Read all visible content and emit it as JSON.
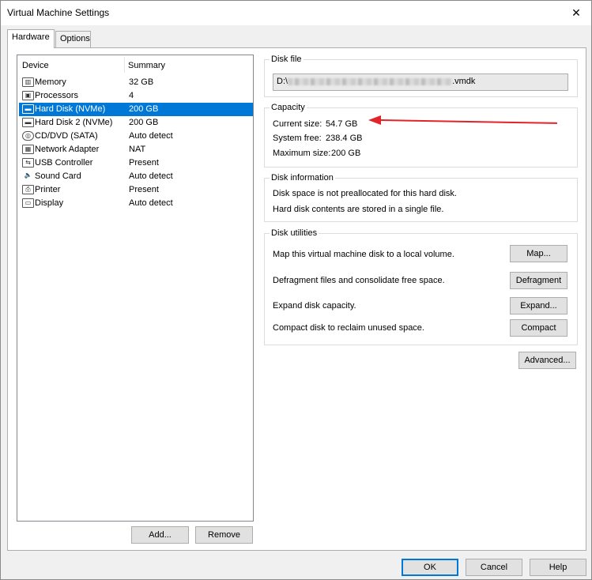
{
  "window": {
    "title": "Virtual Machine Settings"
  },
  "tabs": [
    {
      "label": "Hardware",
      "active": true
    },
    {
      "label": "Options",
      "active": false
    }
  ],
  "device_list": {
    "columns": {
      "device": "Device",
      "summary": "Summary"
    },
    "items": [
      {
        "icon": "memory-icon",
        "name": "Memory",
        "summary": "32 GB",
        "selected": false
      },
      {
        "icon": "processor-icon",
        "name": "Processors",
        "summary": "4",
        "selected": false
      },
      {
        "icon": "hard-disk-icon",
        "name": "Hard Disk (NVMe)",
        "summary": "200 GB",
        "selected": true
      },
      {
        "icon": "hard-disk-icon",
        "name": "Hard Disk 2 (NVMe)",
        "summary": "200 GB",
        "selected": false
      },
      {
        "icon": "cd-dvd-icon",
        "name": "CD/DVD (SATA)",
        "summary": "Auto detect",
        "selected": false
      },
      {
        "icon": "network-adapter-icon",
        "name": "Network Adapter",
        "summary": "NAT",
        "selected": false
      },
      {
        "icon": "usb-icon",
        "name": "USB Controller",
        "summary": "Present",
        "selected": false
      },
      {
        "icon": "sound-icon",
        "name": "Sound Card",
        "summary": "Auto detect",
        "selected": false
      },
      {
        "icon": "printer-icon",
        "name": "Printer",
        "summary": "Present",
        "selected": false
      },
      {
        "icon": "display-icon",
        "name": "Display",
        "summary": "Auto detect",
        "selected": false
      }
    ],
    "add_label": "Add...",
    "remove_label": "Remove"
  },
  "disk_file": {
    "title": "Disk file",
    "prefix": "D:\\",
    "suffix": ".vmdk"
  },
  "capacity": {
    "title": "Capacity",
    "current_label": "Current size:",
    "current_value": "54.7 GB",
    "system_free_label": "System free:",
    "system_free_value": "238.4 GB",
    "max_label": "Maximum size:",
    "max_value": "200 GB"
  },
  "disk_information": {
    "title": "Disk information",
    "line1": "Disk space is not preallocated for this hard disk.",
    "line2": "Hard disk contents are stored in a single file."
  },
  "disk_utilities": {
    "title": "Disk utilities",
    "rows": [
      {
        "text": "Map this virtual machine disk to a local volume.",
        "button": "Map..."
      },
      {
        "text": "Defragment files and consolidate free space.",
        "button": "Defragment"
      },
      {
        "text": "Expand disk capacity.",
        "button": "Expand..."
      },
      {
        "text": "Compact disk to reclaim unused space.",
        "button": "Compact"
      }
    ]
  },
  "advanced_label": "Advanced...",
  "footer": {
    "ok": "OK",
    "cancel": "Cancel",
    "help": "Help"
  },
  "colors": {
    "selection": "#0078d7",
    "annotation_arrow": "#e0242a"
  }
}
